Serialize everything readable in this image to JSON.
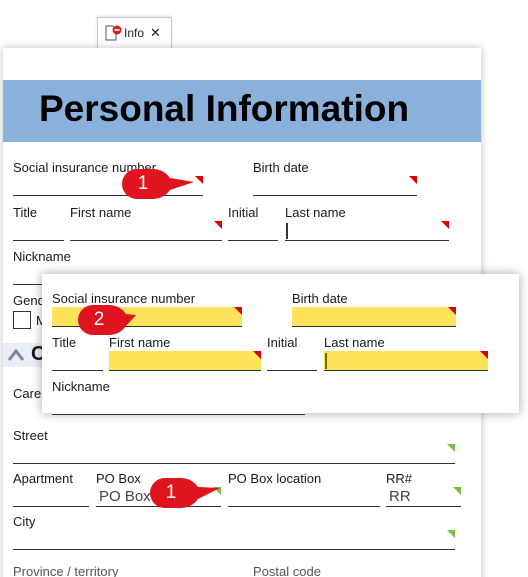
{
  "tab": {
    "label": "Info",
    "close": "✕"
  },
  "form": {
    "title": "Personal Information",
    "social_label": "Social insurance number",
    "birth_label": "Birth date",
    "title_label": "Title",
    "first_label": "First name",
    "initial_label": "Initial",
    "last_label": "Last name",
    "nickname_label": "Nickname",
    "gender_label": "Gend",
    "gender_option": "M",
    "section_letter": "C",
    "care_label": "Care",
    "street_label": "Street",
    "apartment_label": "Apartment",
    "pobox_label": "PO Box",
    "pobox_value": "PO Box",
    "pobox_location_label": "PO Box location",
    "rr_label": "RR#",
    "rr_value": "RR",
    "city_label": "City",
    "province_label": "Province / territory",
    "postal_label": "Postal code"
  },
  "panel": {
    "social_label": "Social insurance number",
    "birth_label": "Birth date",
    "title_label": "Title",
    "first_label": "First name",
    "initial_label": "Initial",
    "last_label": "Last name",
    "nickname_label": "Nickname"
  },
  "callouts": {
    "first": "1",
    "second": "2",
    "third": "1"
  },
  "colors": {
    "header": "#8ab0dc",
    "required_marker": "#e00000",
    "optional_marker": "#7ac143",
    "highlight": "#fde35a",
    "callout": "#e0141e"
  }
}
